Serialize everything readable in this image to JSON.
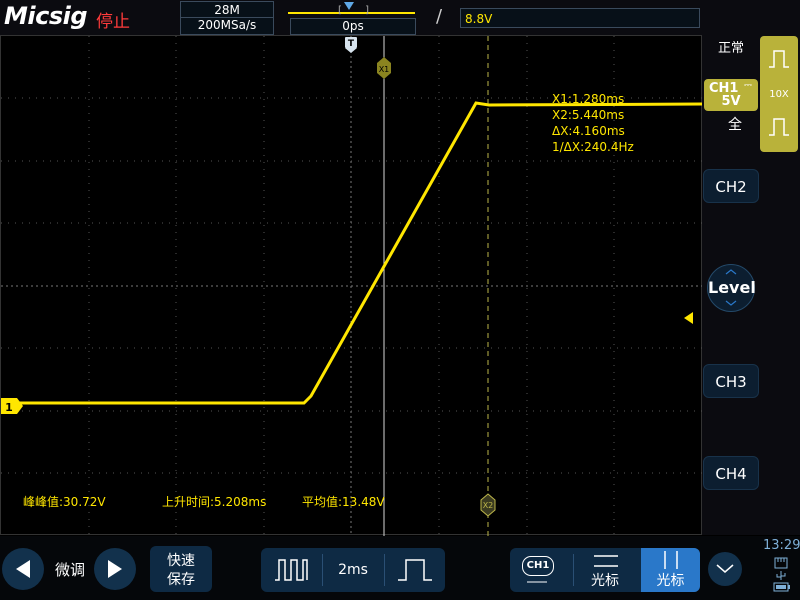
{
  "header": {
    "logo": "Micsig",
    "run_status": "停止",
    "memory_depth": "28M",
    "sample_rate": "200MSa/s",
    "horizontal_delay": "0ps",
    "trigger_level": "⑘8.8V"
  },
  "colors": {
    "ch1": "#ffe600",
    "ch1_panel": "#b9b23a",
    "stopped": "#ff3b3b",
    "button_bg": "#0e2a44",
    "active_button": "#2a78c9"
  },
  "right_panel": {
    "acq_mode": "正常",
    "ch1": {
      "label": "CH1",
      "coupling_symbol": "⎓",
      "scale": "5V",
      "probe": "10X",
      "bandwidth": "全"
    },
    "ch2": "CH2",
    "level": "Level",
    "ch3": "CH3",
    "ch4": "CH4"
  },
  "screen": {
    "ch1_marker": "1",
    "trigger_marker": "T",
    "cursor_x1_tag": "X1",
    "cursor_x2_tag": "X2",
    "cursor_readout": {
      "x1": "X1:1.280ms",
      "x2": "X2:5.440ms",
      "dx": "ΔX:4.160ms",
      "inv_dx": "1/ΔX:240.4Hz"
    },
    "measurements": [
      {
        "label": "峰峰值:30.72V"
      },
      {
        "label": "上升时间:5.208ms"
      },
      {
        "label": "平均值:13.48V"
      }
    ],
    "waveform": {
      "channel": "CH1",
      "units": "ms",
      "x1_ms": 1.28,
      "x2_ms": 5.44
    }
  },
  "bottom_bar": {
    "fine_tune": "微调",
    "save_line1": "快速",
    "save_line2": "保存",
    "timebase": "2ms",
    "ch1_chip": "CH1",
    "cursor_h_label": "光标",
    "cursor_v_label": "光标",
    "clock": "13:29"
  }
}
